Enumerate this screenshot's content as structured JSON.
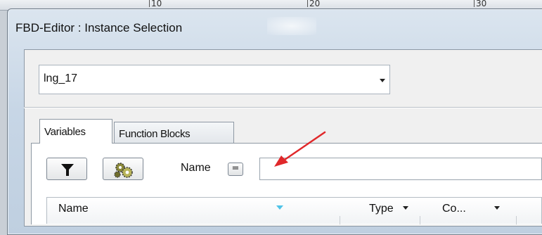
{
  "background": {
    "ruler_ticks": [
      "10",
      "20",
      "30"
    ]
  },
  "window": {
    "title": "FBD-Editor : Instance Selection"
  },
  "instance_combo": {
    "value": "lng_17"
  },
  "tabs": [
    {
      "label": "Variables",
      "active": true
    },
    {
      "label": "Function Blocks",
      "active": false
    }
  ],
  "toolbar": {
    "filter_icon": "filter-icon",
    "settings_icon": "gears-icon",
    "name_label": "Name",
    "operator_label": "=",
    "name_value": ""
  },
  "grid": {
    "columns": [
      {
        "label": "Name",
        "sorted": true
      },
      {
        "label": "Type",
        "filter": true
      },
      {
        "label": "Co...",
        "filter": true
      }
    ]
  },
  "colors": {
    "annotation_arrow": "#e0282a",
    "sort_indicator": "#4fc3e8",
    "dialog_frame": "#c7d6e6"
  }
}
